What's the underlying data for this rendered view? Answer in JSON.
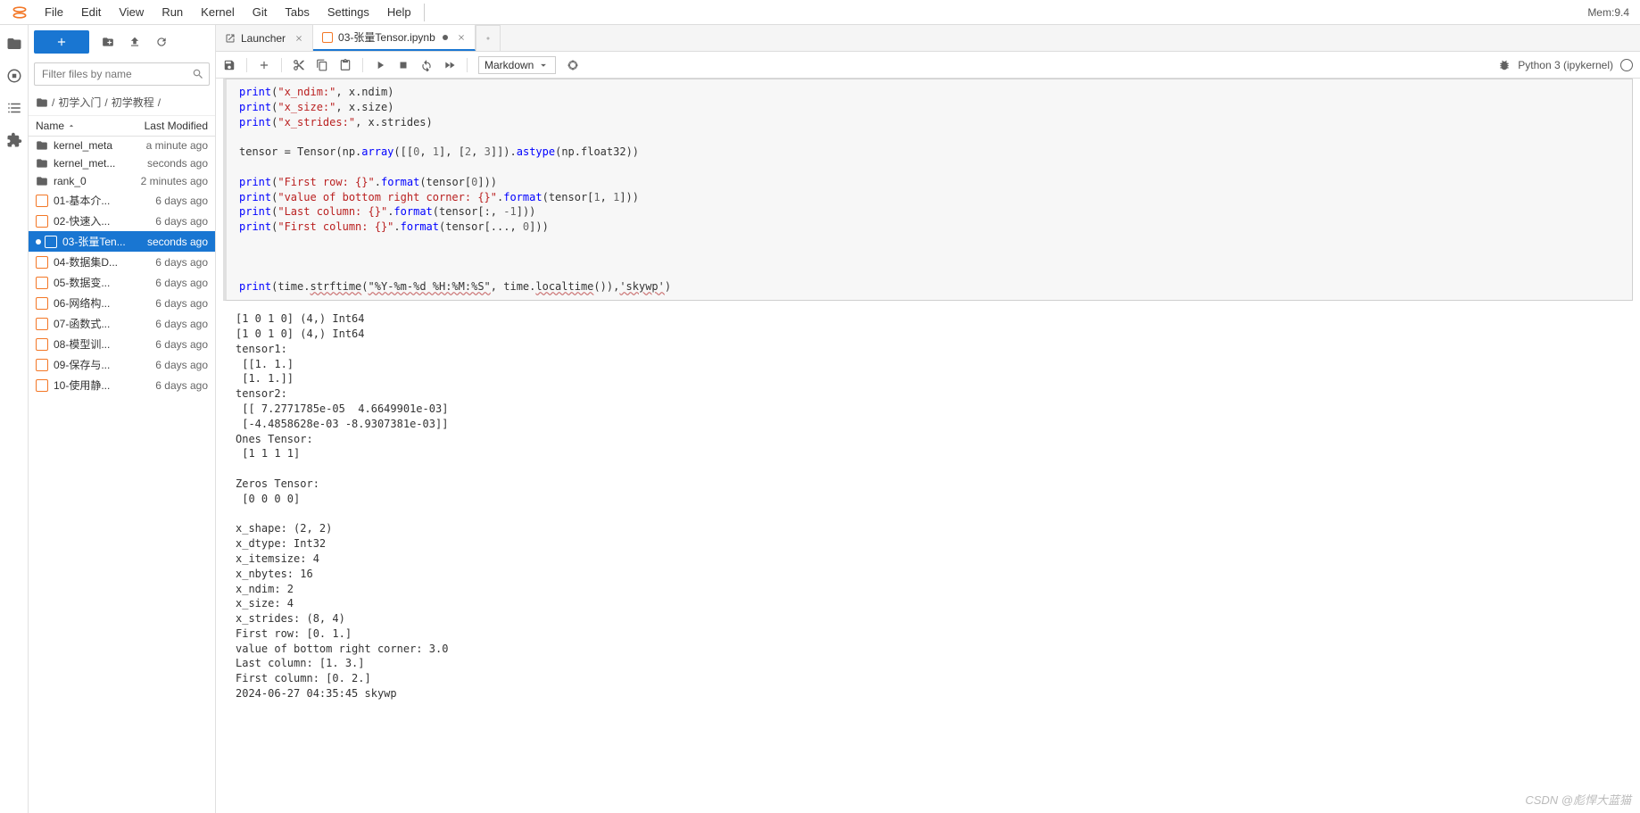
{
  "menubar": {
    "items": [
      "File",
      "Edit",
      "View",
      "Run",
      "Kernel",
      "Git",
      "Tabs",
      "Settings",
      "Help"
    ],
    "mem": "Mem:9.4"
  },
  "file_panel": {
    "filter_placeholder": "Filter files by name",
    "breadcrumb": [
      "/",
      "初学入门",
      "/",
      "初学教程",
      "/"
    ],
    "header": {
      "name": "Name",
      "modified": "Last Modified"
    },
    "files": [
      {
        "icon": "folder",
        "name": "kernel_meta",
        "mod": "a minute ago"
      },
      {
        "icon": "folder",
        "name": "kernel_met...",
        "mod": "seconds ago"
      },
      {
        "icon": "folder",
        "name": "rank_0",
        "mod": "2 minutes ago"
      },
      {
        "icon": "nb",
        "name": "01-基本介...",
        "mod": "6 days ago"
      },
      {
        "icon": "nb",
        "name": "02-快速入...",
        "mod": "6 days ago"
      },
      {
        "icon": "nb",
        "name": "03-张量Ten...",
        "mod": "seconds ago",
        "selected": true,
        "dot": true
      },
      {
        "icon": "nb",
        "name": "04-数据集D...",
        "mod": "6 days ago"
      },
      {
        "icon": "nb",
        "name": "05-数据变...",
        "mod": "6 days ago"
      },
      {
        "icon": "nb",
        "name": "06-网络构...",
        "mod": "6 days ago"
      },
      {
        "icon": "nb",
        "name": "07-函数式...",
        "mod": "6 days ago"
      },
      {
        "icon": "nb",
        "name": "08-模型训...",
        "mod": "6 days ago"
      },
      {
        "icon": "nb",
        "name": "09-保存与...",
        "mod": "6 days ago"
      },
      {
        "icon": "nb",
        "name": "10-使用静...",
        "mod": "6 days ago"
      }
    ]
  },
  "tabs": [
    {
      "icon": "launcher",
      "label": "Launcher",
      "close": true
    },
    {
      "icon": "nb",
      "label": "03-张量Tensor.ipynb",
      "close": true,
      "active": true,
      "dot": true
    }
  ],
  "toolbar": {
    "cell_type": "Markdown",
    "kernel": "Python 3 (ipykernel)"
  },
  "code_lines": [
    [
      {
        "t": "print",
        "c": "c-fn"
      },
      {
        "t": "("
      },
      {
        "t": "\"x_ndim:\"",
        "c": "c-str"
      },
      {
        "t": ", x.ndim)"
      }
    ],
    [
      {
        "t": "print",
        "c": "c-fn"
      },
      {
        "t": "("
      },
      {
        "t": "\"x_size:\"",
        "c": "c-str"
      },
      {
        "t": ", x.size)"
      }
    ],
    [
      {
        "t": "print",
        "c": "c-fn"
      },
      {
        "t": "("
      },
      {
        "t": "\"x_strides:\"",
        "c": "c-str"
      },
      {
        "t": ", x.strides)"
      }
    ],
    [
      {
        "t": ""
      }
    ],
    [
      {
        "t": "tensor = Tensor(np."
      },
      {
        "t": "array",
        "c": "c-fn"
      },
      {
        "t": "([["
      },
      {
        "t": "0",
        "c": "c-num"
      },
      {
        "t": ", "
      },
      {
        "t": "1",
        "c": "c-num"
      },
      {
        "t": "], ["
      },
      {
        "t": "2",
        "c": "c-num"
      },
      {
        "t": ", "
      },
      {
        "t": "3",
        "c": "c-num"
      },
      {
        "t": "]])."
      },
      {
        "t": "astype",
        "c": "c-fn"
      },
      {
        "t": "(np.float32))"
      }
    ],
    [
      {
        "t": ""
      }
    ],
    [
      {
        "t": "print",
        "c": "c-fn"
      },
      {
        "t": "("
      },
      {
        "t": "\"First row: {}\"",
        "c": "c-str"
      },
      {
        "t": "."
      },
      {
        "t": "format",
        "c": "c-fn"
      },
      {
        "t": "(tensor["
      },
      {
        "t": "0",
        "c": "c-num"
      },
      {
        "t": "]))"
      }
    ],
    [
      {
        "t": "print",
        "c": "c-fn"
      },
      {
        "t": "("
      },
      {
        "t": "\"value of bottom right corner: {}\"",
        "c": "c-str"
      },
      {
        "t": "."
      },
      {
        "t": "format",
        "c": "c-fn"
      },
      {
        "t": "(tensor["
      },
      {
        "t": "1",
        "c": "c-num"
      },
      {
        "t": ", "
      },
      {
        "t": "1",
        "c": "c-num"
      },
      {
        "t": "]))"
      }
    ],
    [
      {
        "t": "print",
        "c": "c-fn"
      },
      {
        "t": "("
      },
      {
        "t": "\"Last column: {}\"",
        "c": "c-str"
      },
      {
        "t": "."
      },
      {
        "t": "format",
        "c": "c-fn"
      },
      {
        "t": "(tensor[:, "
      },
      {
        "t": "-1",
        "c": "c-num"
      },
      {
        "t": "]))"
      }
    ],
    [
      {
        "t": "print",
        "c": "c-fn"
      },
      {
        "t": "("
      },
      {
        "t": "\"First column: {}\"",
        "c": "c-str"
      },
      {
        "t": "."
      },
      {
        "t": "format",
        "c": "c-fn"
      },
      {
        "t": "(tensor[..., "
      },
      {
        "t": "0",
        "c": "c-num"
      },
      {
        "t": "]))"
      }
    ],
    [
      {
        "t": ""
      }
    ],
    [
      {
        "t": ""
      }
    ],
    [
      {
        "t": ""
      }
    ],
    [
      {
        "t": "print",
        "c": "c-fn"
      },
      {
        "t": "(time."
      },
      {
        "t": "strftime",
        "c": "c-strt"
      },
      {
        "t": "("
      },
      {
        "t": "\"%Y-%m-%d %H:%M:%S\"",
        "c": "c-strt"
      },
      {
        "t": ", time."
      },
      {
        "t": "localtime",
        "c": "c-strt"
      },
      {
        "t": "()),"
      },
      {
        "t": "'skywp'",
        "c": "c-strt"
      },
      {
        "t": ")"
      }
    ]
  ],
  "output": "[1 0 1 0] (4,) Int64\n[1 0 1 0] (4,) Int64\ntensor1:\n [[1. 1.]\n [1. 1.]]\ntensor2:\n [[ 7.2771785e-05  4.6649901e-03]\n [-4.4858628e-03 -8.9307381e-03]]\nOnes Tensor:\n [1 1 1 1]\n\nZeros Tensor:\n [0 0 0 0]\n\nx_shape: (2, 2)\nx_dtype: Int32\nx_itemsize: 4\nx_nbytes: 16\nx_ndim: 2\nx_size: 4\nx_strides: (8, 4)\nFirst row: [0. 1.]\nvalue of bottom right corner: 3.0\nLast column: [1. 3.]\nFirst column: [0. 2.]\n2024-06-27 04:35:45 skywp",
  "watermark": "CSDN @彪悍大蓝猫"
}
